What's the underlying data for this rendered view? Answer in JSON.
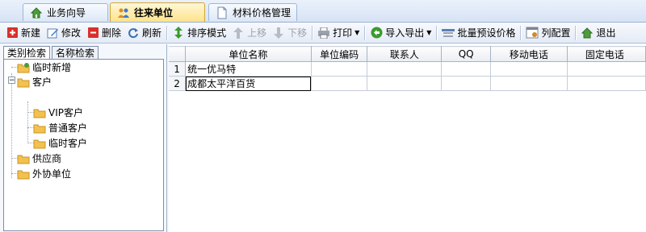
{
  "tabs": [
    {
      "label": "业务向导",
      "icon": "home-icon",
      "active": false
    },
    {
      "label": "往来单位",
      "icon": "people-icon",
      "active": true
    },
    {
      "label": "材料价格管理",
      "icon": "document-icon",
      "active": false
    }
  ],
  "toolbar": {
    "new": "新建",
    "edit": "修改",
    "delete": "删除",
    "refresh": "刷新",
    "sort_mode": "排序模式",
    "move_up": "上移",
    "move_down": "下移",
    "print": "打印",
    "import_export": "导入导出",
    "batch_price": "批量预设价格",
    "column_config": "列配置",
    "exit": "退出"
  },
  "left_panel": {
    "tabs": [
      "类别检索",
      "名称检索"
    ],
    "tree": {
      "n0": "临时新增",
      "n1": "客户",
      "n1_0": "VIP客户",
      "n1_1": "普通客户",
      "n1_2": "临时客户",
      "n2": "供应商",
      "n3": "外协单位"
    }
  },
  "grid": {
    "columns": [
      "单位名称",
      "单位编码",
      "联系人",
      "QQ",
      "移动电话",
      "固定电话"
    ],
    "rows": [
      {
        "no": "1",
        "name": "统一优马特",
        "code": "",
        "contact": "",
        "qq": "",
        "mobile": "",
        "phone": ""
      },
      {
        "no": "2",
        "name": "成都太平洋百货",
        "code": "",
        "contact": "",
        "qq": "",
        "mobile": "",
        "phone": ""
      }
    ]
  },
  "colors": {
    "active_tab": "#ffe28a",
    "new_icon": "#d9302c",
    "delete_icon": "#d9302c",
    "sort_icon": "#3a9a2e",
    "folder": "#f2c14e"
  }
}
